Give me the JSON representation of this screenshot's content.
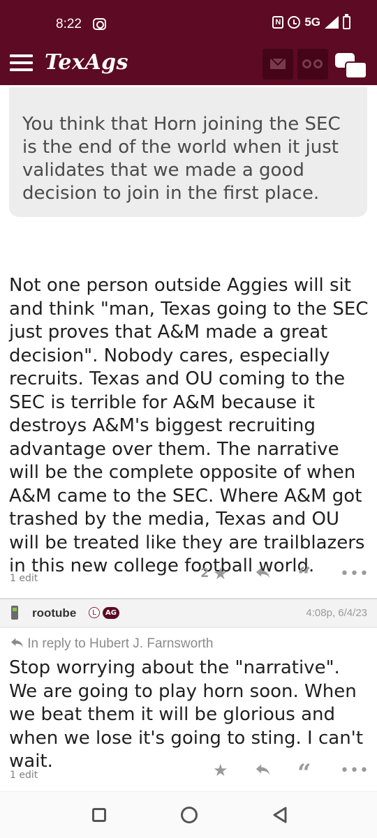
{
  "status_bar": {
    "time": "8:22",
    "network": "5G",
    "nfc_label": "N"
  },
  "header": {
    "logo": "TexAgs",
    "icons": [
      "menu-icon",
      "mail-icon",
      "binoculars-icon",
      "chat-icon"
    ],
    "brand_color": "#5d0a25"
  },
  "quoted_post": {
    "text": "You think that Horn joining the SEC is the end of the world when it just validates that we made a good decision to join in the first place."
  },
  "post1": {
    "body": "Not one person outside Aggies will sit and think \"man, Texas going to the SEC just proves that A&M made a great decision\". Nobody cares, especially recruits. Texas and OU coming to the SEC is terrible for A&M because it destroys A&M's biggest recruiting advantage over them. The narrative will be the complete opposite of when A&M came to the SEC. Where A&M got trashed by the media, Texas and OU will be treated like they are trailblazers in this new college football world.",
    "edit_note": "1 edit",
    "star_count": "2"
  },
  "post2": {
    "username": "rootube",
    "badge_l": "L",
    "badge_ag": "AG",
    "timestamp": "4:08p, 6/4/23",
    "reply_to": "In reply to Hubert J. Farnsworth",
    "body": "Stop worrying about the \"narrative\". We are going to play horn soon. When we beat them it will be glorious and when we lose it's going to sting. I can't wait.",
    "edit_note": "1 edit"
  },
  "action_glyphs": {
    "star": "★",
    "quote": "“",
    "more": "•••",
    "reply_arrow": "↩"
  }
}
